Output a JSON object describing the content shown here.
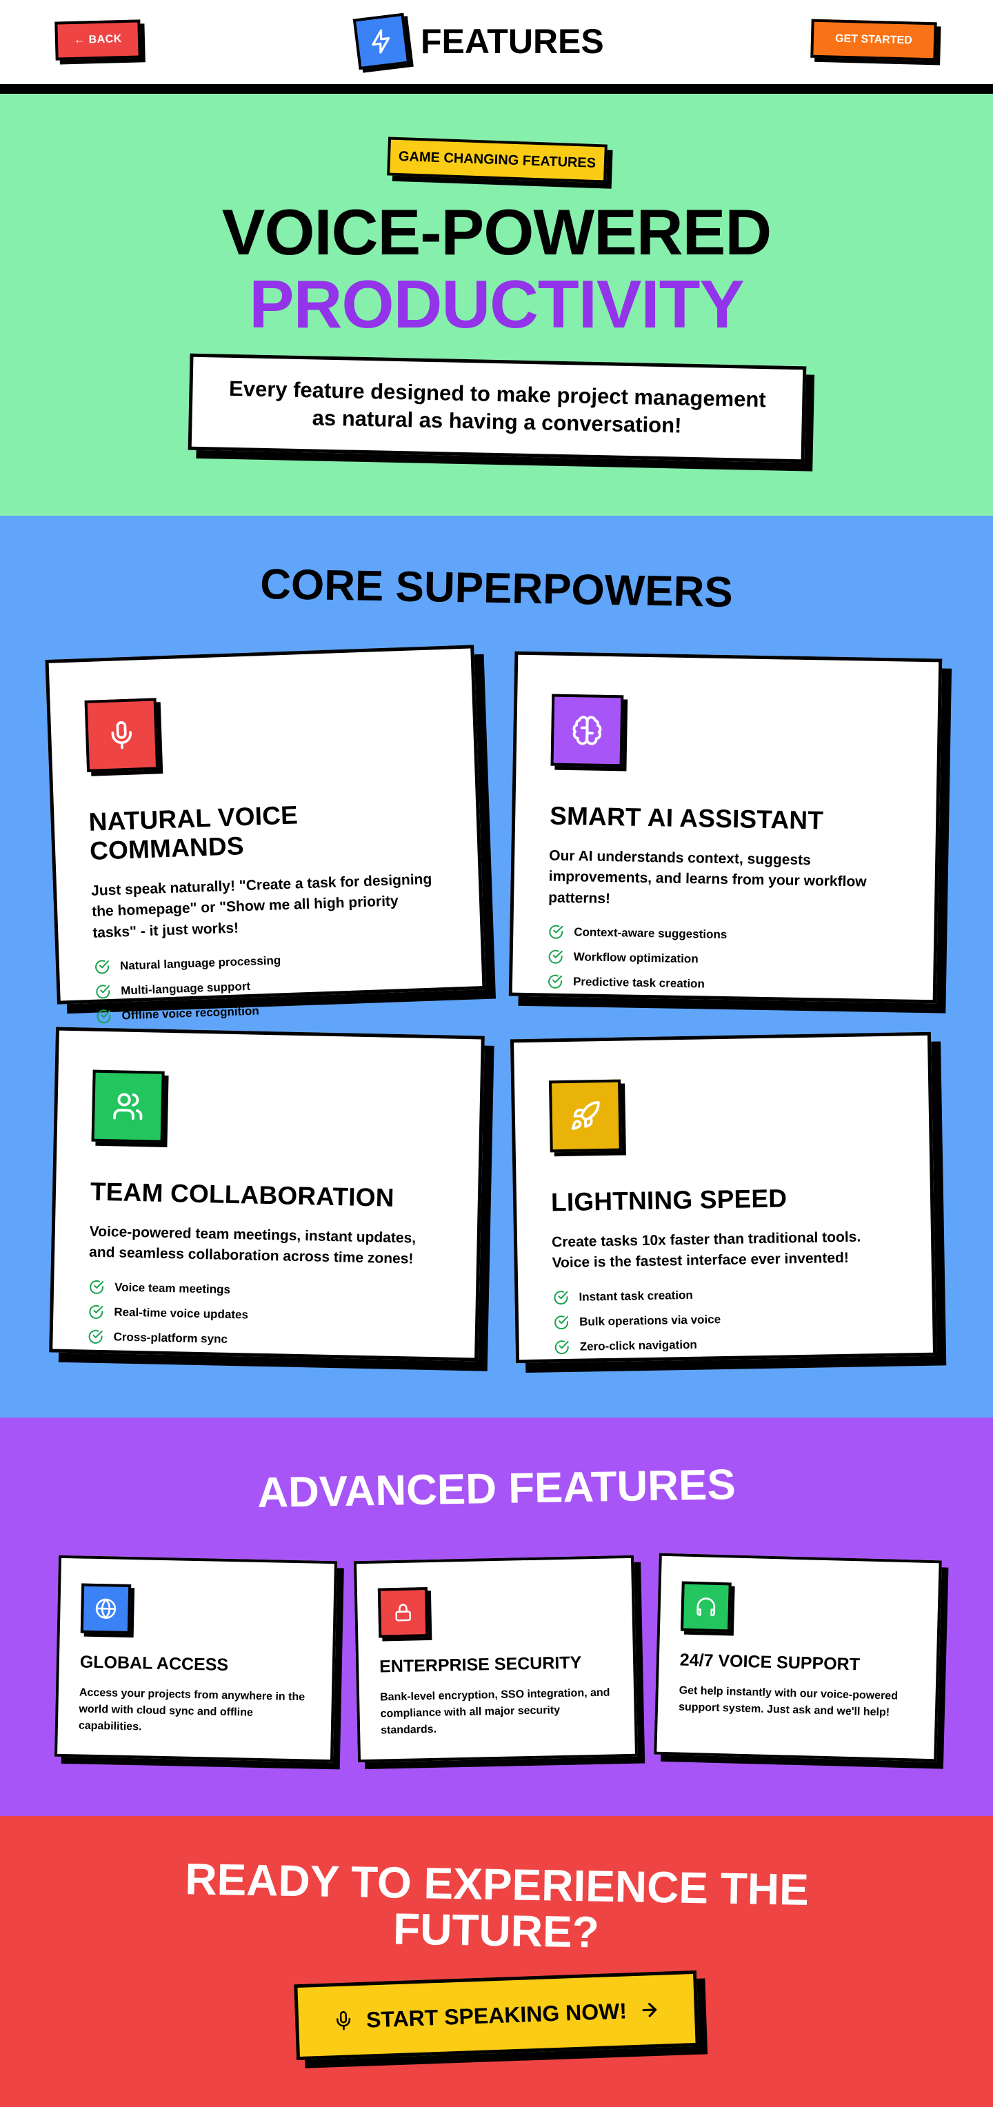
{
  "header": {
    "back_label": "← BACK",
    "title": "FEATURES",
    "get_started_label": "GET STARTED",
    "logo_icon": "lightning-icon"
  },
  "hero": {
    "badge": "GAME CHANGING FEATURES",
    "title_line1": "VOICE-POWERED",
    "title_line2": "PRODUCTIVITY",
    "description": "Every feature designed to make project management as natural as having a conversation!"
  },
  "core": {
    "title": "CORE SUPERPOWERS",
    "cards": [
      {
        "icon": "microphone-icon",
        "color": "#ef4444",
        "title": "NATURAL VOICE COMMANDS",
        "description": "Just speak naturally! \"Create a task for designing the homepage\" or \"Show me all high priority tasks\" - it just works!",
        "features": [
          "Natural language processing",
          "Multi-language support",
          "Offline voice recognition"
        ]
      },
      {
        "icon": "brain-icon",
        "color": "#a855f7",
        "title": "SMART AI ASSISTANT",
        "description": "Our AI understands context, suggests improvements, and learns from your workflow patterns!",
        "features": [
          "Context-aware suggestions",
          "Workflow optimization",
          "Predictive task creation"
        ]
      },
      {
        "icon": "users-icon",
        "color": "#22c55e",
        "title": "TEAM COLLABORATION",
        "description": "Voice-powered team meetings, instant updates, and seamless collaboration across time zones!",
        "features": [
          "Voice team meetings",
          "Real-time voice updates",
          "Cross-platform sync"
        ]
      },
      {
        "icon": "rocket-icon",
        "color": "#eab308",
        "title": "LIGHTNING SPEED",
        "description": "Create tasks 10x faster than traditional tools. Voice is the fastest interface ever invented!",
        "features": [
          "Instant task creation",
          "Bulk operations via voice",
          "Zero-click navigation"
        ]
      }
    ]
  },
  "advanced": {
    "title": "ADVANCED FEATURES",
    "items": [
      {
        "icon": "globe-icon",
        "color": "#3b82f6",
        "title": "GLOBAL ACCESS",
        "description": "Access your projects from anywhere in the world with cloud sync and offline capabilities."
      },
      {
        "icon": "lock-icon",
        "color": "#ef4444",
        "title": "ENTERPRISE SECURITY",
        "description": "Bank-level encryption, SSO integration, and compliance with all major security standards."
      },
      {
        "icon": "headphones-icon",
        "color": "#22c55e",
        "title": "24/7 VOICE SUPPORT",
        "description": "Get help instantly with our voice-powered support system. Just ask and we'll help!"
      }
    ]
  },
  "cta": {
    "title_line1": "READY TO EXPERIENCE THE",
    "title_line2": "FUTURE?",
    "button_label": "START SPEAKING NOW!"
  },
  "colors": {
    "hero_bg": "#86efac",
    "core_bg": "#60a5fa",
    "advanced_bg": "#a855f7",
    "cta_bg": "#ef4444",
    "accent_purple": "#9333ea",
    "badge_yellow": "#facc15",
    "check_green": "#16a34a"
  }
}
